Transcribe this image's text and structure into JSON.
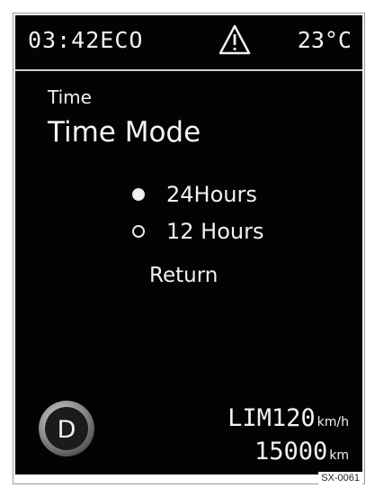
{
  "status_bar": {
    "clock": "03:42",
    "mode": "ECO",
    "temperature": "23°C",
    "warning_icon": "warning-triangle-icon"
  },
  "menu": {
    "breadcrumb": "Time",
    "title": "Time Mode",
    "options": [
      {
        "label": "24Hours",
        "selected": true
      },
      {
        "label": "12 Hours",
        "selected": false
      }
    ],
    "return_label": "Return"
  },
  "footer": {
    "gear": "D",
    "speed_limit": "LIM120",
    "speed_unit": "km/h",
    "odometer": "15000",
    "odometer_unit": "km"
  },
  "figure_code": "SX-0061",
  "colors": {
    "screen_bg": "#030303",
    "text": "#f2f2f2",
    "gear_ring": "#9a9a9a"
  }
}
